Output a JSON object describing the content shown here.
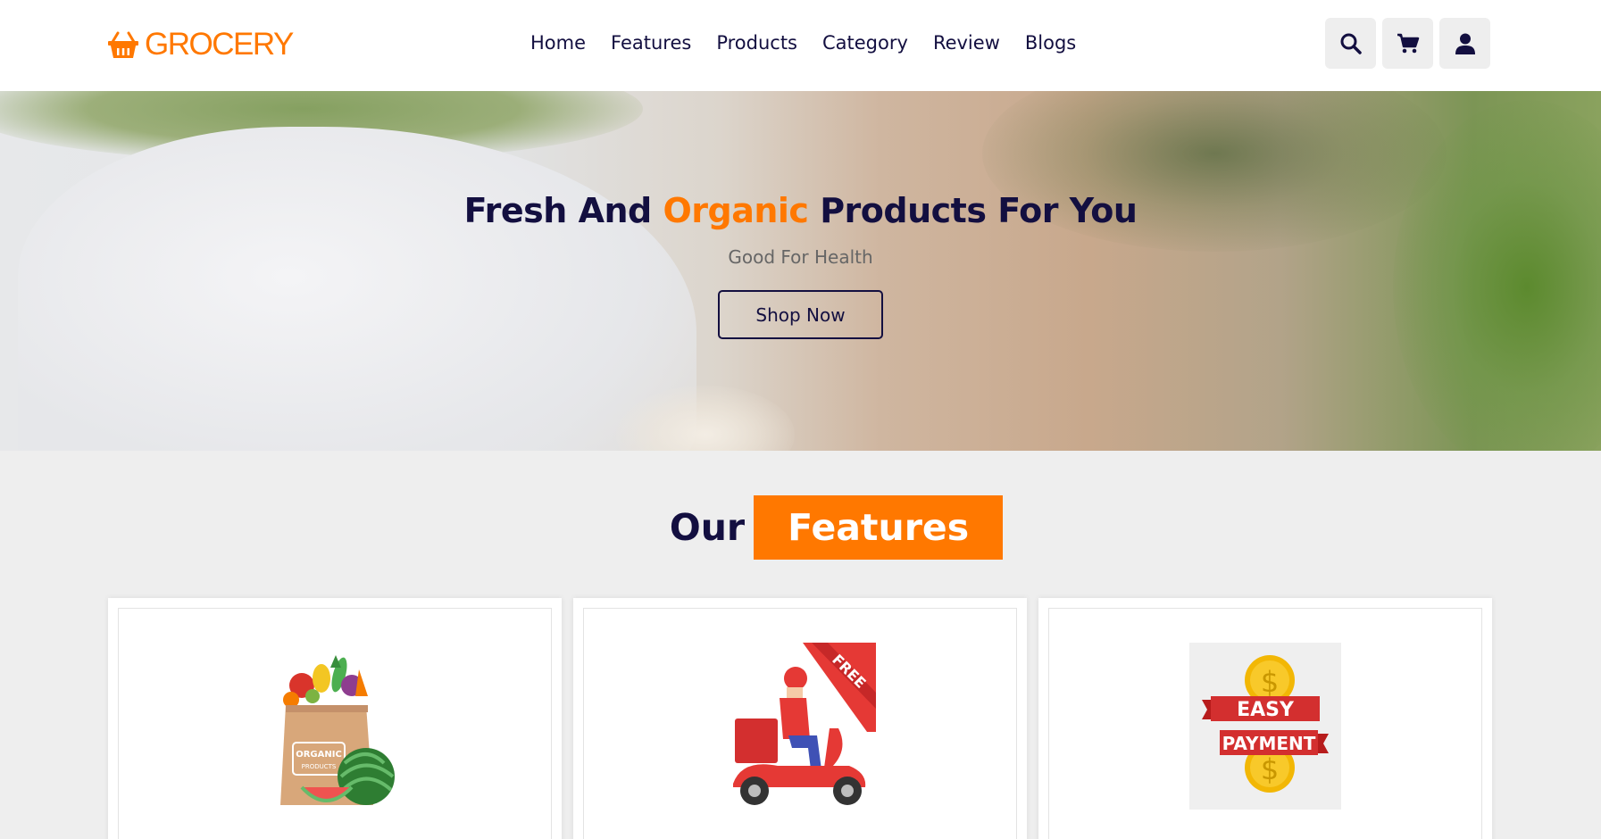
{
  "brand": {
    "name": "GROCERY",
    "icon": "basket-icon",
    "color": "#ff7800"
  },
  "nav": {
    "items": [
      "Home",
      "Features",
      "Products",
      "Category",
      "Review",
      "Blogs"
    ]
  },
  "header_icons": [
    "search-icon",
    "cart-icon",
    "user-icon"
  ],
  "hero": {
    "title_pre": "Fresh And ",
    "title_accent": "Organic",
    "title_post": " Products For You",
    "subtitle": "Good For Health",
    "button_label": "Shop Now"
  },
  "features": {
    "heading_part1": "Our",
    "heading_part2": "Features",
    "cards": [
      {
        "image": "organic-products-bag-illustration",
        "badge_text": "ORGANIC",
        "badge_sub": "PRODUCTS"
      },
      {
        "image": "free-delivery-scooter-illustration",
        "badge_text": "FREE"
      },
      {
        "image": "easy-payment-coins-illustration",
        "badge_text": "EASY",
        "badge_sub": "PAYMENT"
      }
    ]
  },
  "colors": {
    "accent": "#ff7800",
    "primary": "#130f40",
    "background": "#eeeeee"
  }
}
